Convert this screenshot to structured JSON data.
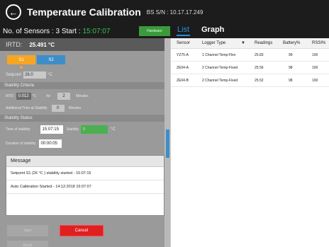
{
  "header": {
    "title": "Temperature Calibration",
    "bs_sn": "BS S/N : 10.17.17.249",
    "back_icon": "arrow-left-circle-icon"
  },
  "sensors_bar": {
    "text": "No. of Sensors : 3  Start :",
    "start_time": "15:07:07",
    "hardware_label": "Hardware"
  },
  "tabs": [
    {
      "label": "List",
      "active": true
    },
    {
      "label": "Graph",
      "active": false
    }
  ],
  "left_panel": {
    "irtd_label": "IRTD:",
    "irtd_value": "25.491 °C",
    "setpoints": [
      "S1",
      "S2"
    ],
    "setpoint_label": "Setpoint",
    "setpoint_value": "26.0",
    "setpoint_unit": "°C",
    "stability_criteria_header": "Stability Criteria",
    "irtd_crit_label": "IRTD",
    "irtd_crit_value": "0.012",
    "irtd_crit_unit": "°C",
    "for_label": "for",
    "minutes_value": "2",
    "minutes_label": "Minutes",
    "additional_label": "Additional Time at Stability",
    "additional_value": "0",
    "additional_minutes_label": "Minutes",
    "stability_status_header": "Stability Status",
    "time_of_stability_label": "Time of stability",
    "time_of_stability_value": "15:07:15",
    "stability_label": "Stability",
    "stability_value": "0",
    "stability_unit": "°C",
    "duration_label": "Duration of stability",
    "duration_value": "00:00:05",
    "message_header": "Message",
    "messages": [
      "Setpoint S1 (26 °C ) stability started - 15:07:15",
      "Auto Calibration Started - 14:12:2018 15:07:07"
    ],
    "start_label": "Start",
    "cancel_label": "Cancel",
    "reset_label": "Reset"
  },
  "table": {
    "columns": [
      "Sensor",
      "Logger Type",
      "Readings",
      "Battery%",
      "RSSI%"
    ],
    "filter_icon": "filter-icon",
    "rows": [
      {
        "sensor": "YZ75-A",
        "logger": "1 Channel Temp-Flex",
        "reading": "25.83",
        "battery": "99",
        "rssi": "100"
      },
      {
        "sensor": "ZE04-A",
        "logger": "2 Channel Temp-Fixed",
        "reading": "25.56",
        "battery": "98",
        "rssi": "100"
      },
      {
        "sensor": "ZE04-B",
        "logger": "2 Channel Temp-Fixed",
        "reading": "25.52",
        "battery": "98",
        "rssi": "100"
      }
    ]
  },
  "colors": {
    "accent_blue": "#2a8fd6",
    "green": "#36c14a",
    "s1_orange": "#f6a623",
    "s2_blue": "#3d8ec8",
    "cancel_red": "#e01f1f"
  }
}
